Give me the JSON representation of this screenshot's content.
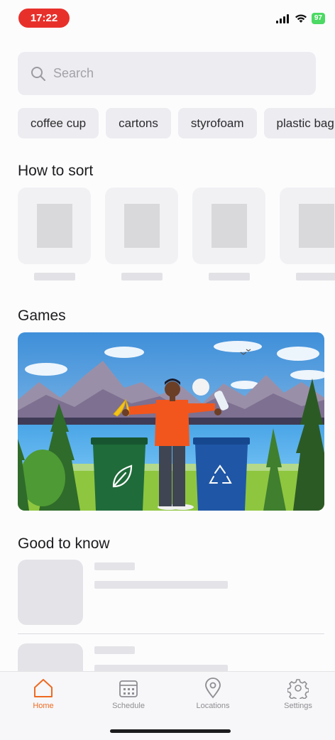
{
  "status": {
    "time": "17:22",
    "battery": "97"
  },
  "search": {
    "placeholder": "Search"
  },
  "chips": [
    "coffee cup",
    "cartons",
    "styrofoam",
    "plastic bag"
  ],
  "sections": {
    "how_to_sort": "How to sort",
    "games": "Games",
    "good_to_know": "Good to know"
  },
  "tabs": [
    {
      "label": "Home",
      "icon": "home-icon",
      "active": true
    },
    {
      "label": "Schedule",
      "icon": "calendar-icon",
      "active": false
    },
    {
      "label": "Locations",
      "icon": "location-pin-icon",
      "active": false
    },
    {
      "label": "Settings",
      "icon": "gear-icon",
      "active": false
    }
  ],
  "colors": {
    "accent": "#ee6a21",
    "time_pill": "#e8302b",
    "compost_bin": "#1f6b3a",
    "recycle_bin": "#1f57a6"
  }
}
